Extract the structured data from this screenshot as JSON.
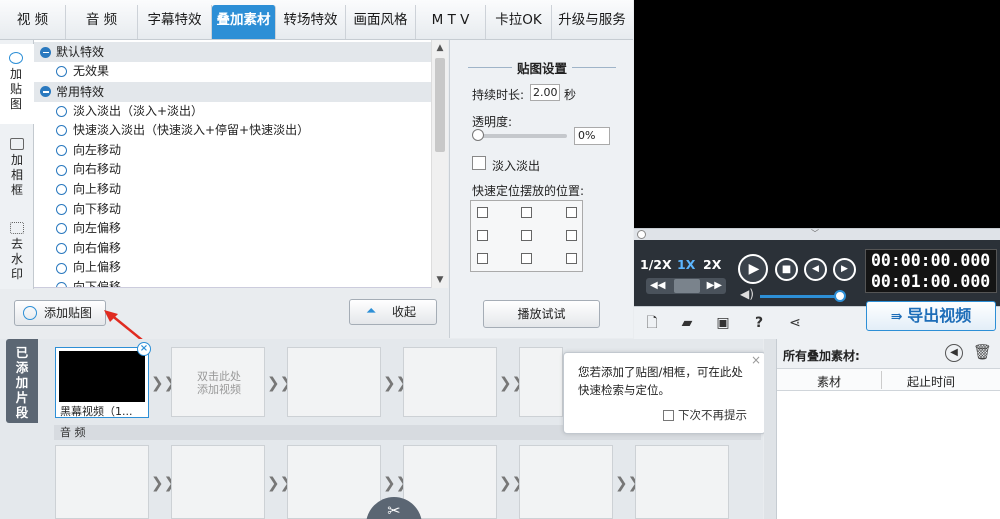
{
  "nav": {
    "tabs": [
      {
        "label": "视  频"
      },
      {
        "label": "音  频"
      },
      {
        "label": "字幕特效"
      },
      {
        "label": "叠加素材"
      },
      {
        "label": "转场特效"
      },
      {
        "label": "画面风格"
      },
      {
        "label": "M T V"
      },
      {
        "label": "卡拉OK"
      },
      {
        "label": "升级与服务"
      }
    ],
    "active_index": 3
  },
  "side_tabs": [
    {
      "label": "加贴图",
      "lines": [
        "加",
        "贴",
        "图"
      ]
    },
    {
      "label": "加相框",
      "lines": [
        "加",
        "相",
        "框"
      ]
    },
    {
      "label": "去水印",
      "lines": [
        "去",
        "水",
        "印"
      ]
    }
  ],
  "effects": {
    "groups": [
      {
        "name": "默认特效",
        "items": [
          "无效果"
        ]
      },
      {
        "name": "常用特效",
        "items": [
          "淡入淡出（淡入+淡出）",
          "快速淡入淡出（快速淡入+停留+快速淡出）",
          "向左移动",
          "向右移动",
          "向上移动",
          "向下移动",
          "向左偏移",
          "向右偏移",
          "向上偏移",
          "向下偏移"
        ]
      }
    ]
  },
  "buttons": {
    "add_sticker": "添加贴图",
    "collapse": "收起",
    "preview": "播放试试",
    "export": "导出视频"
  },
  "settings": {
    "title": "贴图设置",
    "duration_label": "持续时长:",
    "duration_value": "2.00",
    "duration_unit": "秒",
    "opacity_label": "透明度:",
    "opacity_value": "0%",
    "opacity_fraction": 0.0,
    "fade_label": "淡入淡出",
    "fade_checked": false,
    "position_label": "快速定位摆放的位置:"
  },
  "player": {
    "speeds": [
      "1/2X",
      "1X",
      "2X"
    ],
    "active_speed": "1X",
    "current_time": "00:00:00.000",
    "total_time": "00:01:00.000",
    "volume_fraction": 0.95,
    "progress_fraction": 0.0
  },
  "timeline": {
    "added_label": "已添加片段",
    "added_lines": [
      "已",
      "添",
      "加",
      "片",
      "段"
    ],
    "clip_name": "黑幕视频（1...",
    "empty_slot_hint": "双击此处\n添加视频",
    "audio_label": "音 频"
  },
  "tooltip": {
    "text": "您若添加了贴图/相框，可在此处快速检索与定位。",
    "dont_show": "下次不再提示",
    "close": "×"
  },
  "overlay_list": {
    "title": "所有叠加素材:",
    "col_material": "素材",
    "col_start": "起止时间"
  },
  "colors": {
    "accent": "#2d8fd6",
    "video_bg": "#000000",
    "control_bg": "#2b3138"
  }
}
